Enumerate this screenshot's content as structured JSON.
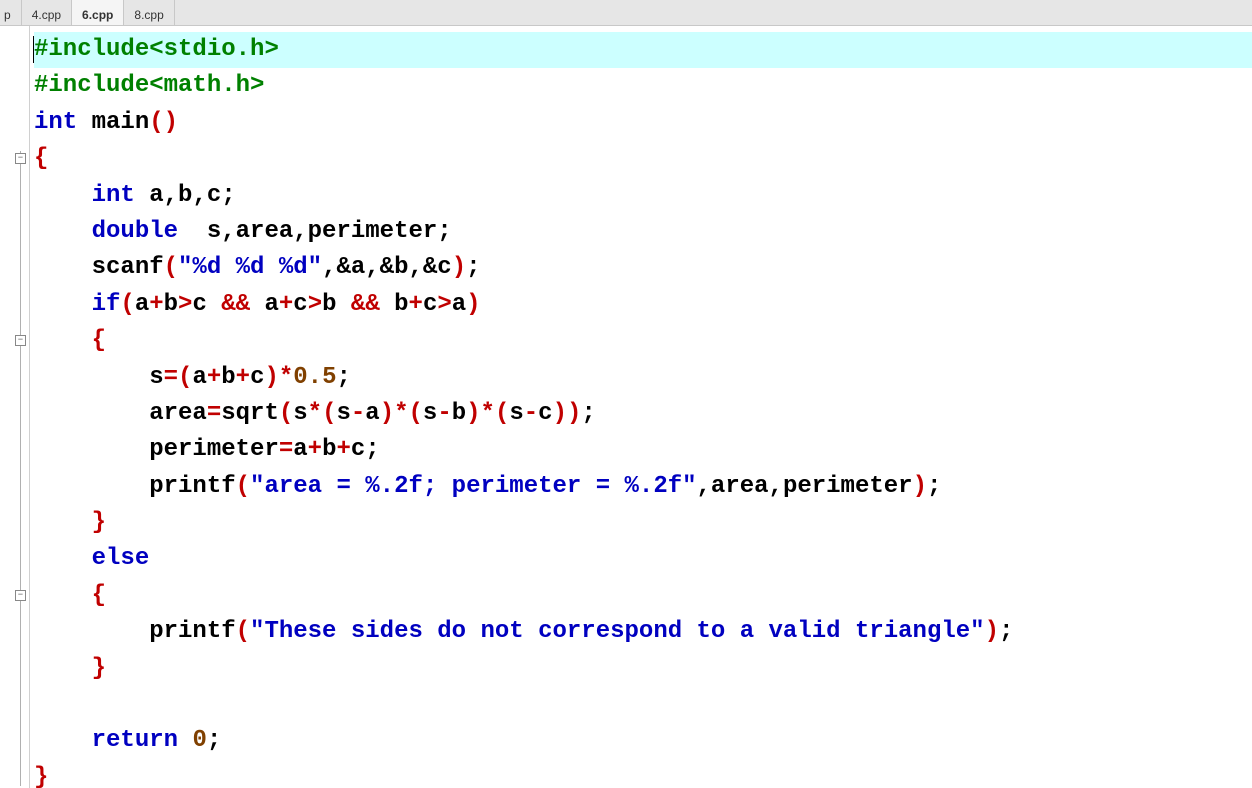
{
  "tabs": {
    "clipped": "p",
    "items": [
      "4.cpp",
      "6.cpp",
      "8.cpp"
    ],
    "active_index": 1
  },
  "fold": {
    "box_glyph": "−"
  },
  "code": {
    "lines": [
      {
        "t": "preproc",
        "text": "#include<stdio.h>",
        "current": true
      },
      {
        "t": "preproc",
        "text": "#include<math.h>"
      },
      {
        "t": "sig",
        "kw": "int",
        "name": " main",
        "p": "()"
      },
      {
        "t": "brace",
        "text": "{"
      },
      {
        "t": "decl",
        "indent": "    ",
        "kw": "int",
        "rest": " a,b,c;"
      },
      {
        "t": "decl",
        "indent": "    ",
        "kw": "double",
        "rest": "  s,area,perimeter;"
      },
      {
        "t": "scanf",
        "indent": "    ",
        "fn": "scanf",
        "p1": "(",
        "s": "\"%d %d %d\"",
        "args": ",&a,&b,&c",
        "p2": ")",
        "semi": ";"
      },
      {
        "t": "if",
        "indent": "    ",
        "kw": "if",
        "p1": "(",
        "e1": "a",
        "op1": "+",
        "e2": "b",
        "op2": ">",
        "e3": "c ",
        "amp1": "&&",
        "sp1": " a",
        "op3": "+",
        "e4": "c",
        "op4": ">",
        "e5": "b ",
        "amp2": "&&",
        "sp2": " b",
        "op5": "+",
        "e6": "c",
        "op6": ">",
        "e7": "a",
        "p2": ")"
      },
      {
        "t": "brace",
        "indent": "    ",
        "text": "{"
      },
      {
        "t": "assign",
        "indent": "        ",
        "lhs": "s",
        "eq": "=",
        "p1": "(",
        "a": "a",
        "op1": "+",
        "b": "b",
        "op2": "+",
        "c": "c",
        "p2": ")",
        "op3": "*",
        "n": "0.5",
        "semi": ";"
      },
      {
        "t": "area",
        "indent": "        ",
        "lhs": "area",
        "eq": "=",
        "fn": "sqrt",
        "p1": "(",
        "s1": "s",
        "op1": "*",
        "p2": "(",
        "s2": "s",
        "op2": "-",
        "a": "a",
        "p3": ")",
        "op3": "*",
        "p4": "(",
        "s3": "s",
        "op4": "-",
        "b": "b",
        "p5": ")",
        "op5": "*",
        "p6": "(",
        "s4": "s",
        "op6": "-",
        "c": "c",
        "p7": "))",
        "semi": ";"
      },
      {
        "t": "peri",
        "indent": "        ",
        "lhs": "perimeter",
        "eq": "=",
        "a": "a",
        "op1": "+",
        "b": "b",
        "op2": "+",
        "c": "c",
        "semi": ";"
      },
      {
        "t": "printf",
        "indent": "        ",
        "fn": "printf",
        "p1": "(",
        "s": "\"area = %.2f; perimeter = %.2f\"",
        "args": ",area,perimeter",
        "p2": ")",
        "semi": ";"
      },
      {
        "t": "brace",
        "indent": "    ",
        "text": "}"
      },
      {
        "t": "kwline",
        "indent": "    ",
        "kw": "else"
      },
      {
        "t": "brace",
        "indent": "    ",
        "text": "{"
      },
      {
        "t": "printf",
        "indent": "        ",
        "fn": "printf",
        "p1": "(",
        "s": "\"These sides do not correspond to a valid triangle\"",
        "args": "",
        "p2": ")",
        "semi": ";"
      },
      {
        "t": "brace",
        "indent": "    ",
        "text": "}"
      },
      {
        "t": "blank",
        "text": ""
      },
      {
        "t": "ret",
        "indent": "    ",
        "kw": "return",
        "sp": " ",
        "n": "0",
        "semi": ";"
      },
      {
        "t": "brace",
        "text": "}"
      }
    ]
  }
}
